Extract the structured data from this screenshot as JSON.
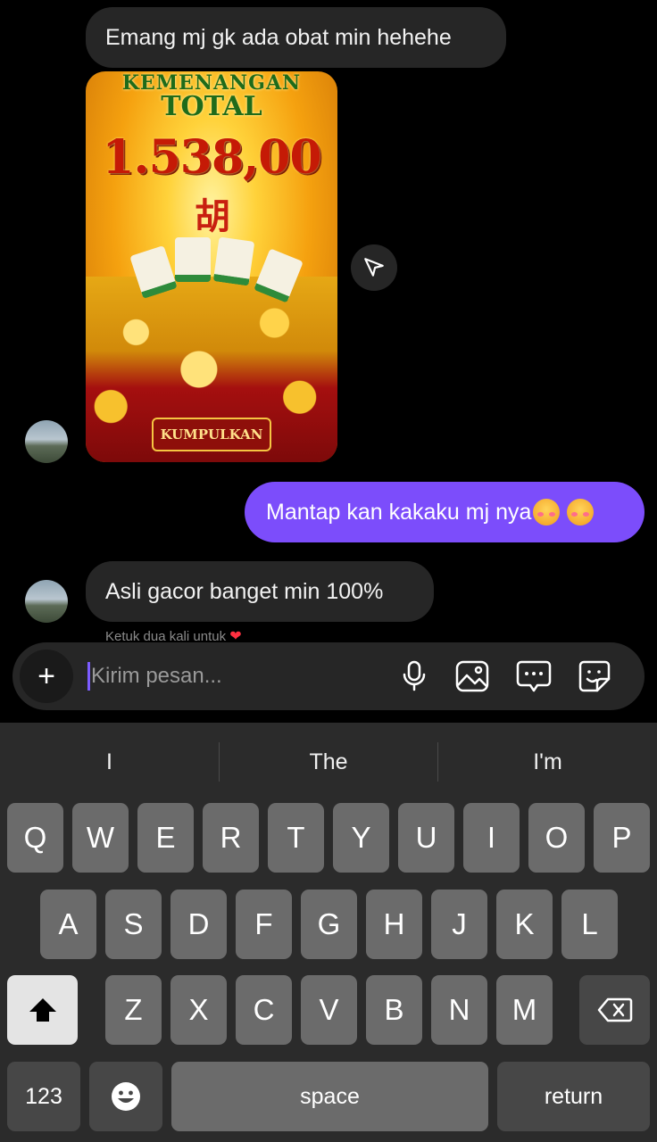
{
  "messages": {
    "m1": "Emang mj gk ada obat min hehehe",
    "m2": "Mantap kan kakaku mj nya",
    "m3": "Asli gacor banget min 100%"
  },
  "game_card": {
    "line1": "KEMENANGAN",
    "line2": "TOTAL",
    "amount": "1.538,00",
    "glyph": "胡",
    "button": "KUMPULKAN"
  },
  "hint": {
    "text": "Ketuk dua kali untuk",
    "heart": "❤"
  },
  "composer": {
    "placeholder": "Kirim pesan...",
    "plus": "+"
  },
  "icons": {
    "share": "send-icon",
    "mic": "microphone-icon",
    "gallery": "image-icon",
    "chat": "chat-bubble-icon",
    "sticker": "sticker-icon"
  },
  "keyboard": {
    "suggestions": [
      "I",
      "The",
      "I'm"
    ],
    "row1": [
      "Q",
      "W",
      "E",
      "R",
      "T",
      "Y",
      "U",
      "I",
      "O",
      "P"
    ],
    "row2": [
      "A",
      "S",
      "D",
      "F",
      "G",
      "H",
      "J",
      "K",
      "L"
    ],
    "row3": [
      "Z",
      "X",
      "C",
      "V",
      "B",
      "N",
      "M"
    ],
    "numbers": "123",
    "space": "space",
    "return": "return"
  },
  "colors": {
    "background": "#000000",
    "incoming_bubble": "#262626",
    "outgoing_bubble": "#7c4dfb",
    "keyboard_bg": "#2b2b2b",
    "key": "#6b6b6b"
  }
}
